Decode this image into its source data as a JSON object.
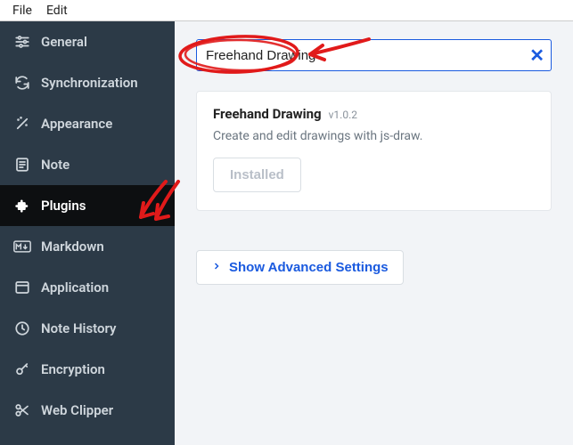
{
  "menubar": {
    "file": "File",
    "edit": "Edit"
  },
  "sidebar": {
    "items": [
      {
        "label": "General"
      },
      {
        "label": "Synchronization"
      },
      {
        "label": "Appearance"
      },
      {
        "label": "Note"
      },
      {
        "label": "Plugins"
      },
      {
        "label": "Markdown"
      },
      {
        "label": "Application"
      },
      {
        "label": "Note History"
      },
      {
        "label": "Encryption"
      },
      {
        "label": "Web Clipper"
      }
    ]
  },
  "search": {
    "value": "Freehand Drawing"
  },
  "plugin": {
    "name": "Freehand Drawing",
    "version": "v1.0.2",
    "description": "Create and edit drawings with js-draw.",
    "install_label": "Installed"
  },
  "advanced": {
    "label": "Show Advanced Settings"
  },
  "colors": {
    "accent": "#1a5adf",
    "annotation": "#e11a1a"
  }
}
